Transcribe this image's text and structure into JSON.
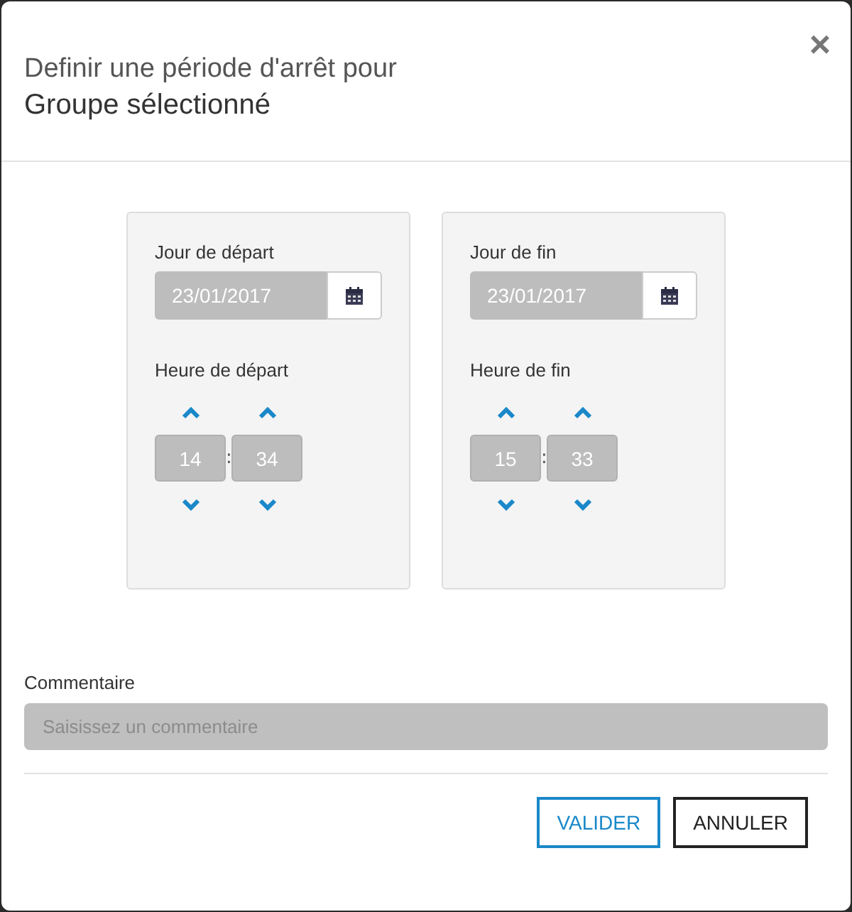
{
  "dialog": {
    "title": "Definir une période d'arrêt pour",
    "subtitle": "Groupe sélectionné",
    "close": "×"
  },
  "periods": [
    {
      "date_label": "Jour de départ",
      "date": "23/01/2017",
      "time_label": "Heure de départ",
      "hours": "14",
      "separator": ":",
      "minutes": "34"
    },
    {
      "date_label": "Jour de fin",
      "date": "23/01/2017",
      "time_label": "Heure de fin",
      "hours": "15",
      "separator": ":",
      "minutes": "33"
    }
  ],
  "comment": {
    "label": "Commentaire",
    "placeholder": "Saisissez un commentaire"
  },
  "buttons": [
    {
      "label": "VALIDER",
      "kind": "primary"
    },
    {
      "label": "ANNULER",
      "kind": "secondary"
    }
  ]
}
